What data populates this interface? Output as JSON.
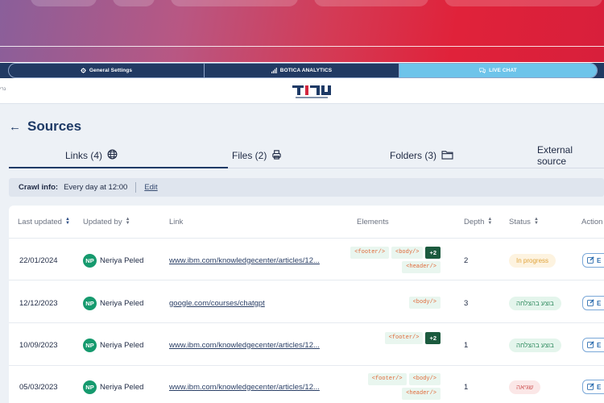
{
  "topnav": {
    "general_settings": "General Settings",
    "analytics": "BOTICA ANALYTICS",
    "live_chat": "LIVE CHAT"
  },
  "logobar": {
    "side_text": "נרי"
  },
  "page": {
    "title": "Sources"
  },
  "source_tabs": [
    {
      "label": "Links (4)",
      "icon": "globe-icon",
      "active": true
    },
    {
      "label": "Files (2)",
      "icon": "printer-icon",
      "active": false
    },
    {
      "label": "Folders (3)",
      "icon": "folder-icon",
      "active": false
    },
    {
      "label": "External source",
      "icon": "",
      "active": false
    }
  ],
  "crawl": {
    "label": "Crawl info:",
    "value": "Every day at 12:00",
    "edit": "Edit"
  },
  "table": {
    "columns": {
      "last_updated": "Last updated",
      "updated_by": "Updated by",
      "link": "Link",
      "elements": "Elements",
      "depth": "Depth",
      "status": "Status",
      "actions": "Action"
    },
    "rows": [
      {
        "date": "22/01/2024",
        "initials": "NP",
        "user": "Neriya Peled",
        "link": "www.ibm.com/knowledgecenter/articles/12...",
        "elements": [
          "<footer/>",
          "<body/>",
          "+2",
          "<header/>"
        ],
        "depth": "2",
        "status": "In progress",
        "status_kind": "progress",
        "action": "E"
      },
      {
        "date": "12/12/2023",
        "initials": "NP",
        "user": "Neriya Peled",
        "link": "google.com/courses/chatgpt",
        "elements": [
          "<body/>"
        ],
        "depth": "3",
        "status": "בוצע בהצלחה",
        "status_kind": "ok",
        "action": "E"
      },
      {
        "date": "10/09/2023",
        "initials": "NP",
        "user": "Neriya Peled",
        "link": "www.ibm.com/knowledgecenter/articles/12...",
        "elements": [
          "<footer/>",
          "+2"
        ],
        "depth": "1",
        "status": "בוצע בהצלחה",
        "status_kind": "ok",
        "action": "E"
      },
      {
        "date": "05/03/2023",
        "initials": "NP",
        "user": "Neriya Peled",
        "link": "www.ibm.com/knowledgecenter/articles/12...",
        "elements": [
          "<footer/>",
          "<body/>",
          "<header/>"
        ],
        "depth": "1",
        "status": "שגיאה",
        "status_kind": "err",
        "action": "E"
      }
    ]
  }
}
